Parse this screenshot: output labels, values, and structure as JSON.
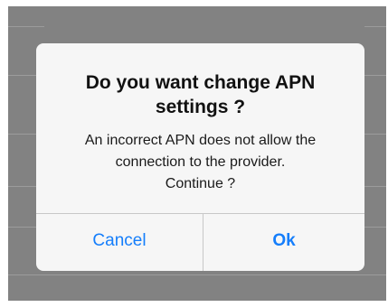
{
  "dialog": {
    "title_line1": "Do you want change APN",
    "title_line2": "settings ?",
    "message_line1": "An incorrect APN does not allow the",
    "message_line2": "connection to the provider.",
    "message_line3": "Continue ?",
    "cancel_label": "Cancel",
    "ok_label": "Ok"
  },
  "colors": {
    "accent": "#157efb",
    "dialog_background": "#f6f6f6",
    "dimmed_background": "#828282"
  }
}
